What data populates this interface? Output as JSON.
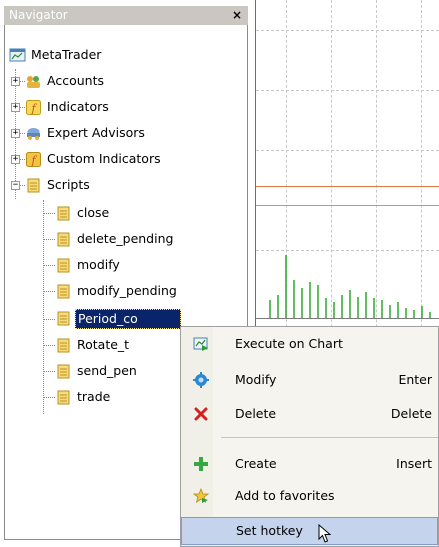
{
  "navigator": {
    "title": "Navigator",
    "close_glyph": "×",
    "tree": [
      {
        "label": "MetaTrader",
        "icon": "metatrader-icon"
      },
      {
        "label": "Accounts",
        "icon": "accounts-icon",
        "expander": "+"
      },
      {
        "label": "Indicators",
        "icon": "indicators-icon",
        "expander": "+"
      },
      {
        "label": "Expert Advisors",
        "icon": "expert-advisors-icon",
        "expander": "+"
      },
      {
        "label": "Custom Indicators",
        "icon": "custom-indicators-icon",
        "expander": "+"
      },
      {
        "label": "Scripts",
        "icon": "scripts-icon",
        "expander": "−"
      },
      {
        "label": "close",
        "icon": "script-icon"
      },
      {
        "label": "delete_pending",
        "icon": "script-icon"
      },
      {
        "label": "modify",
        "icon": "script-icon"
      },
      {
        "label": "modify_pending",
        "icon": "script-icon"
      },
      {
        "label": "Period_co",
        "icon": "script-icon",
        "selected": true
      },
      {
        "label": "Rotate_t",
        "icon": "script-icon"
      },
      {
        "label": "send_pen",
        "icon": "script-icon"
      },
      {
        "label": "trade",
        "icon": "script-icon"
      }
    ]
  },
  "context_menu": {
    "items": [
      {
        "label": "Execute on Chart",
        "shortcut": "",
        "icon": "execute-chart-icon"
      },
      {
        "label": "Modify",
        "shortcut": "Enter",
        "icon": "modify-gear-icon"
      },
      {
        "label": "Delete",
        "shortcut": "Delete",
        "icon": "delete-x-icon"
      },
      {
        "label": "Create",
        "shortcut": "Insert",
        "icon": "create-plus-icon"
      },
      {
        "label": "Add to favorites",
        "shortcut": "",
        "icon": "favorites-star-icon"
      },
      {
        "label": "Set hotkey",
        "shortcut": "",
        "icon": "",
        "hover": true
      }
    ]
  },
  "colors": {
    "selection": "#0a246a",
    "menu_hover": "#c5d3ec",
    "price_line": "#e0793a",
    "volume_bars": "#2ea82e"
  }
}
